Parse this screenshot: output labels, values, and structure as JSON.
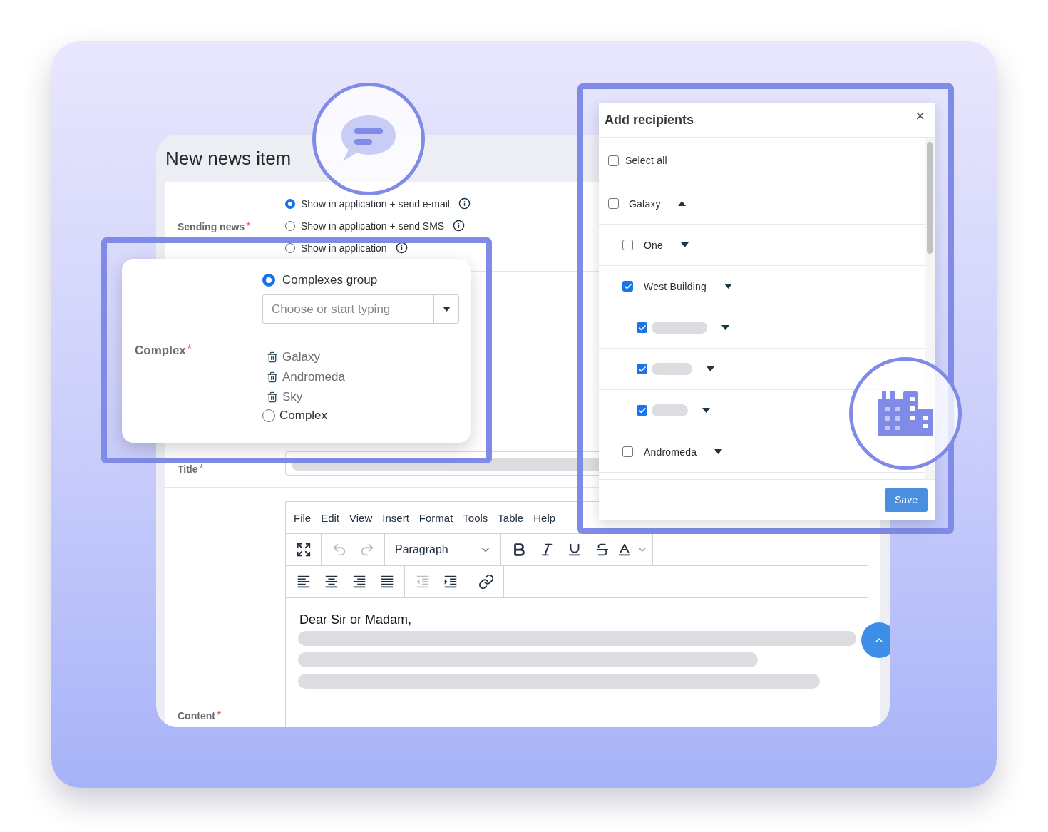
{
  "page": {
    "title": "New news item"
  },
  "sending_news": {
    "label": "Sending news",
    "required_mark": "*",
    "options": [
      {
        "label": "Show in application + send e-mail",
        "selected": true
      },
      {
        "label": "Show in application + send SMS",
        "selected": false
      },
      {
        "label": "Show in application",
        "selected": false
      }
    ]
  },
  "complex_popup": {
    "label": "Complex",
    "required_mark": "*",
    "options": [
      {
        "label": "Complexes group",
        "selected": true
      },
      {
        "label": "Complex",
        "selected": false
      }
    ],
    "select": {
      "placeholder": "Choose or start typing"
    },
    "chosen": [
      "Galaxy",
      "Andromeda",
      "Sky"
    ]
  },
  "title_field": {
    "label": "Title",
    "required_mark": "*"
  },
  "editor": {
    "label": "Content",
    "required_mark": "*",
    "menu": [
      "File",
      "Edit",
      "View",
      "Insert",
      "Format",
      "Tools",
      "Table",
      "Help"
    ],
    "toolbar_rows": [
      [
        [
          {
            "kind": "fullscreen",
            "disabled": false
          }
        ],
        [
          {
            "kind": "undo",
            "disabled": true
          },
          {
            "kind": "redo",
            "disabled": true
          }
        ],
        [
          {
            "kind": "block_format",
            "label": "Paragraph"
          }
        ],
        [
          {
            "kind": "bold",
            "disabled": false
          },
          {
            "kind": "italic",
            "disabled": false
          },
          {
            "kind": "underline",
            "disabled": false
          },
          {
            "kind": "strikethrough",
            "disabled": false
          },
          {
            "kind": "text_color",
            "disabled": false
          }
        ]
      ],
      [
        [
          {
            "kind": "align_left",
            "disabled": false
          },
          {
            "kind": "align_center",
            "disabled": false
          },
          {
            "kind": "align_right",
            "disabled": false
          },
          {
            "kind": "align_justify",
            "disabled": false
          }
        ],
        [
          {
            "kind": "outdent",
            "disabled": true
          },
          {
            "kind": "indent",
            "disabled": false
          }
        ],
        [
          {
            "kind": "link",
            "disabled": false
          }
        ]
      ]
    ],
    "text": "Dear Sir or Madam,"
  },
  "recipients": {
    "title": "Add recipients",
    "close": "×",
    "items": [
      {
        "kind": "option",
        "label": "Select all",
        "checked": false
      },
      {
        "kind": "group",
        "label": "Galaxy",
        "checked": false,
        "expanded": true,
        "children": [
          {
            "kind": "group",
            "label": "One",
            "checked": false,
            "expanded": false
          },
          {
            "kind": "group",
            "label": "West Building",
            "checked": true,
            "expanded": false,
            "children": [
              {
                "kind": "redacted",
                "checked": true,
                "expanded": false
              },
              {
                "kind": "redacted",
                "checked": true,
                "expanded": false
              },
              {
                "kind": "redacted",
                "checked": true,
                "expanded": false
              }
            ]
          },
          {
            "kind": "group",
            "label": "Andromeda",
            "checked": false,
            "expanded": false
          }
        ]
      }
    ],
    "save": "Save"
  }
}
